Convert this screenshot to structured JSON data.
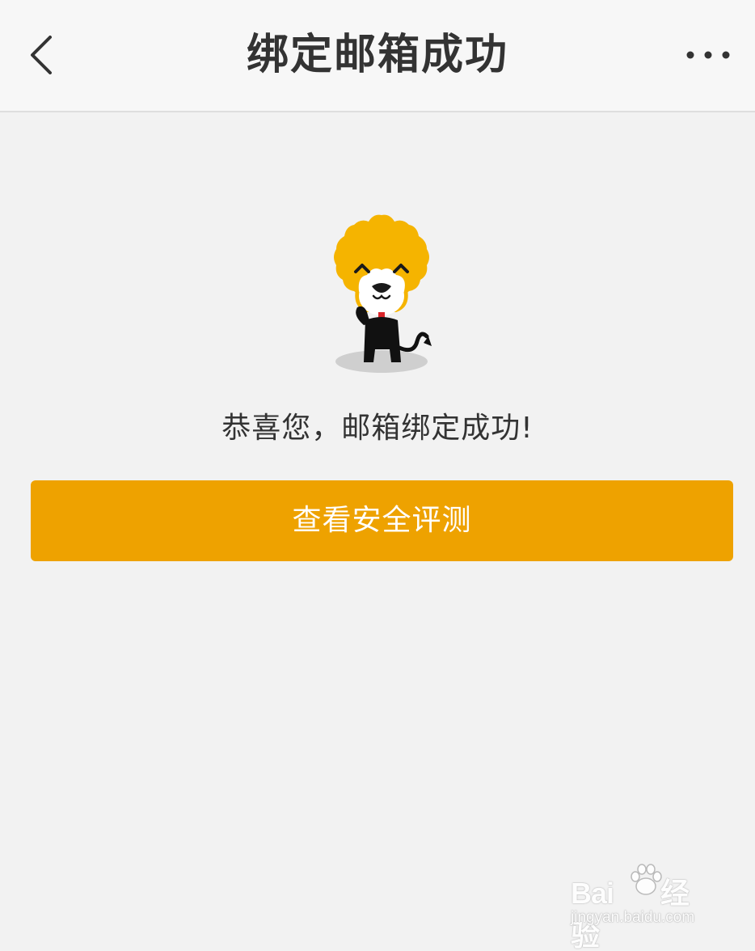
{
  "nav": {
    "title": "绑定邮箱成功",
    "back_icon": "chevron-left-icon",
    "more_icon": "more-horizontal-icon"
  },
  "main": {
    "mascot": "lion-mascot-icon",
    "message": "恭喜您，邮箱绑定成功!",
    "button_label": "查看安全评测"
  },
  "watermark": {
    "brand": "Bai",
    "brand_suffix": "经验",
    "url": "jingyan.baidu.com"
  },
  "colors": {
    "background": "#f2f2f2",
    "navbar": "#f7f7f7",
    "accent": "#eea200",
    "mascot_yellow": "#f5b400",
    "text": "#333333"
  }
}
